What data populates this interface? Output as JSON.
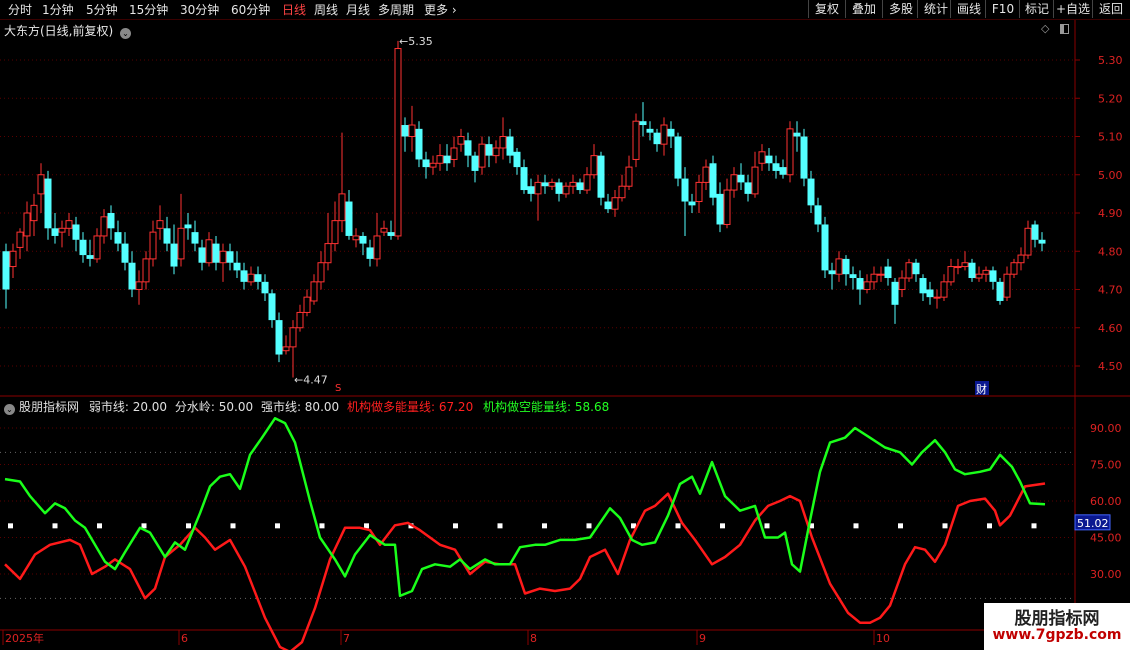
{
  "toolbar": {
    "periods": [
      {
        "label": "分时",
        "active": false
      },
      {
        "label": "1分钟",
        "active": false
      },
      {
        "label": "5分钟",
        "active": false
      },
      {
        "label": "15分钟",
        "active": false
      },
      {
        "label": "30分钟",
        "active": false
      },
      {
        "label": "60分钟",
        "active": false
      },
      {
        "label": "日线",
        "active": true
      },
      {
        "label": "周线",
        "active": false
      },
      {
        "label": "月线",
        "active": false
      },
      {
        "label": "多周期",
        "active": false
      },
      {
        "label": "更多",
        "active": false
      }
    ],
    "buttons": [
      "复权",
      "叠加",
      "多股",
      "统计",
      "画线",
      "F10",
      "标记",
      "+自选",
      "返回"
    ]
  },
  "main_chart": {
    "title": "大东方(日线,前复权)",
    "price_ticks": [
      "5.30",
      "5.20",
      "5.10",
      "5.00",
      "4.90",
      "4.80",
      "4.70",
      "4.60",
      "4.50"
    ],
    "high_label": "5.35",
    "low_label": "4.47",
    "marker_s": "S",
    "marker_cai": "财",
    "colors": {
      "up": "#ff3232",
      "down": "#54ffff",
      "grid": "#5a0000",
      "axis": "#8a0000",
      "tick_text": "#dd2222"
    }
  },
  "indicator": {
    "name": "股朋指标网",
    "weak_label": "弱市线: ",
    "weak_value": "20.00",
    "mid_label": "分水岭: ",
    "mid_value": "50.00",
    "strong_label": "强市线: ",
    "strong_value": "80.00",
    "long_label": "机构做多能量线: ",
    "long_value": "67.20",
    "short_label": "机构做空能量线: ",
    "short_value": "58.68",
    "value_ticks": [
      "90.00",
      "75.00",
      "60.00",
      "45.00",
      "30.00"
    ],
    "cursor_value": "51.02",
    "colors": {
      "long": "#ff1a1a",
      "short": "#1aff1a",
      "cursor_bg": "#0a1890"
    }
  },
  "time_axis": {
    "labels": [
      "2025年",
      "6",
      "7",
      "8",
      "9",
      "10"
    ]
  },
  "watermark": {
    "line1": "股朋指标网",
    "line2": "www.7gpzb.com"
  }
}
